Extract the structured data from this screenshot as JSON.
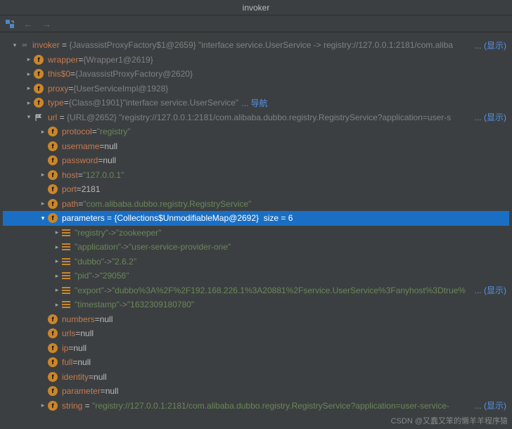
{
  "title": "invoker",
  "toolbar": {
    "back": "←",
    "forward": "→"
  },
  "root": {
    "name": "invoker",
    "obj": "{JavassistProxyFactory$1@2659}",
    "desc": "\"interface service.UserService -> registry://127.0.0.1:2181/com.aliba",
    "link": "显示"
  },
  "children": [
    {
      "name": "wrapper",
      "obj": "{Wrapper1@2619}"
    },
    {
      "name": "this$0",
      "obj": "{JavassistProxyFactory@2620}"
    },
    {
      "name": "proxy",
      "obj": "{UserServiceImpl@1928}"
    },
    {
      "name": "type",
      "obj": "{Class@1901}",
      "extra": "\"interface service.UserService\"",
      "navlink": "导航"
    }
  ],
  "url": {
    "name": "url",
    "obj": "{URL@2652}",
    "desc": "\"registry://127.0.0.1:2181/com.alibaba.dubbo.registry.RegistryService?application=user-s",
    "link": "显示",
    "fields": [
      {
        "name": "protocol",
        "val": "\"registry\"",
        "k": "str",
        "arrow": true
      },
      {
        "name": "username",
        "val": "null",
        "k": "nul"
      },
      {
        "name": "password",
        "val": "null",
        "k": "nul"
      },
      {
        "name": "host",
        "val": "\"127.0.0.1\"",
        "k": "str",
        "arrow": true
      },
      {
        "name": "port",
        "val": "2181",
        "k": "nul"
      },
      {
        "name": "path",
        "val": "\"com.alibaba.dubbo.registry.RegistryService\"",
        "k": "str",
        "arrow": true
      }
    ],
    "params": {
      "name": "parameters",
      "obj": "{Collections$UnmodifiableMap@2692}",
      "size": "size = 6",
      "entries": [
        {
          "k": "\"registry\"",
          "v": "\"zookeeper\""
        },
        {
          "k": "\"application\"",
          "v": "\"user-service-provider-one\""
        },
        {
          "k": "\"dubbo\"",
          "v": "\"2.6.2\""
        },
        {
          "k": "\"pid\"",
          "v": "\"29056\""
        },
        {
          "k": "\"export\"",
          "v": "\"dubbo%3A%2F%2F192.168.226.1%3A20881%2Fservice.UserService%3Fanyhost%3Dtrue%",
          "link": "显示"
        },
        {
          "k": "\"timestamp\"",
          "v": "\"1632309180780\""
        }
      ]
    },
    "after": [
      {
        "name": "numbers",
        "val": "null"
      },
      {
        "name": "urls",
        "val": "null"
      },
      {
        "name": "ip",
        "val": "null"
      },
      {
        "name": "full",
        "val": "null"
      },
      {
        "name": "identity",
        "val": "null"
      },
      {
        "name": "parameter",
        "val": "null"
      }
    ],
    "string": {
      "name": "string",
      "val": "\"registry://127.0.0.1:2181/com.alibaba.dubbo.registry.RegistryService?application=user-service-",
      "link": "显示"
    }
  },
  "watermark": "CSDN @又蠢又笨的懒羊羊程序猿"
}
